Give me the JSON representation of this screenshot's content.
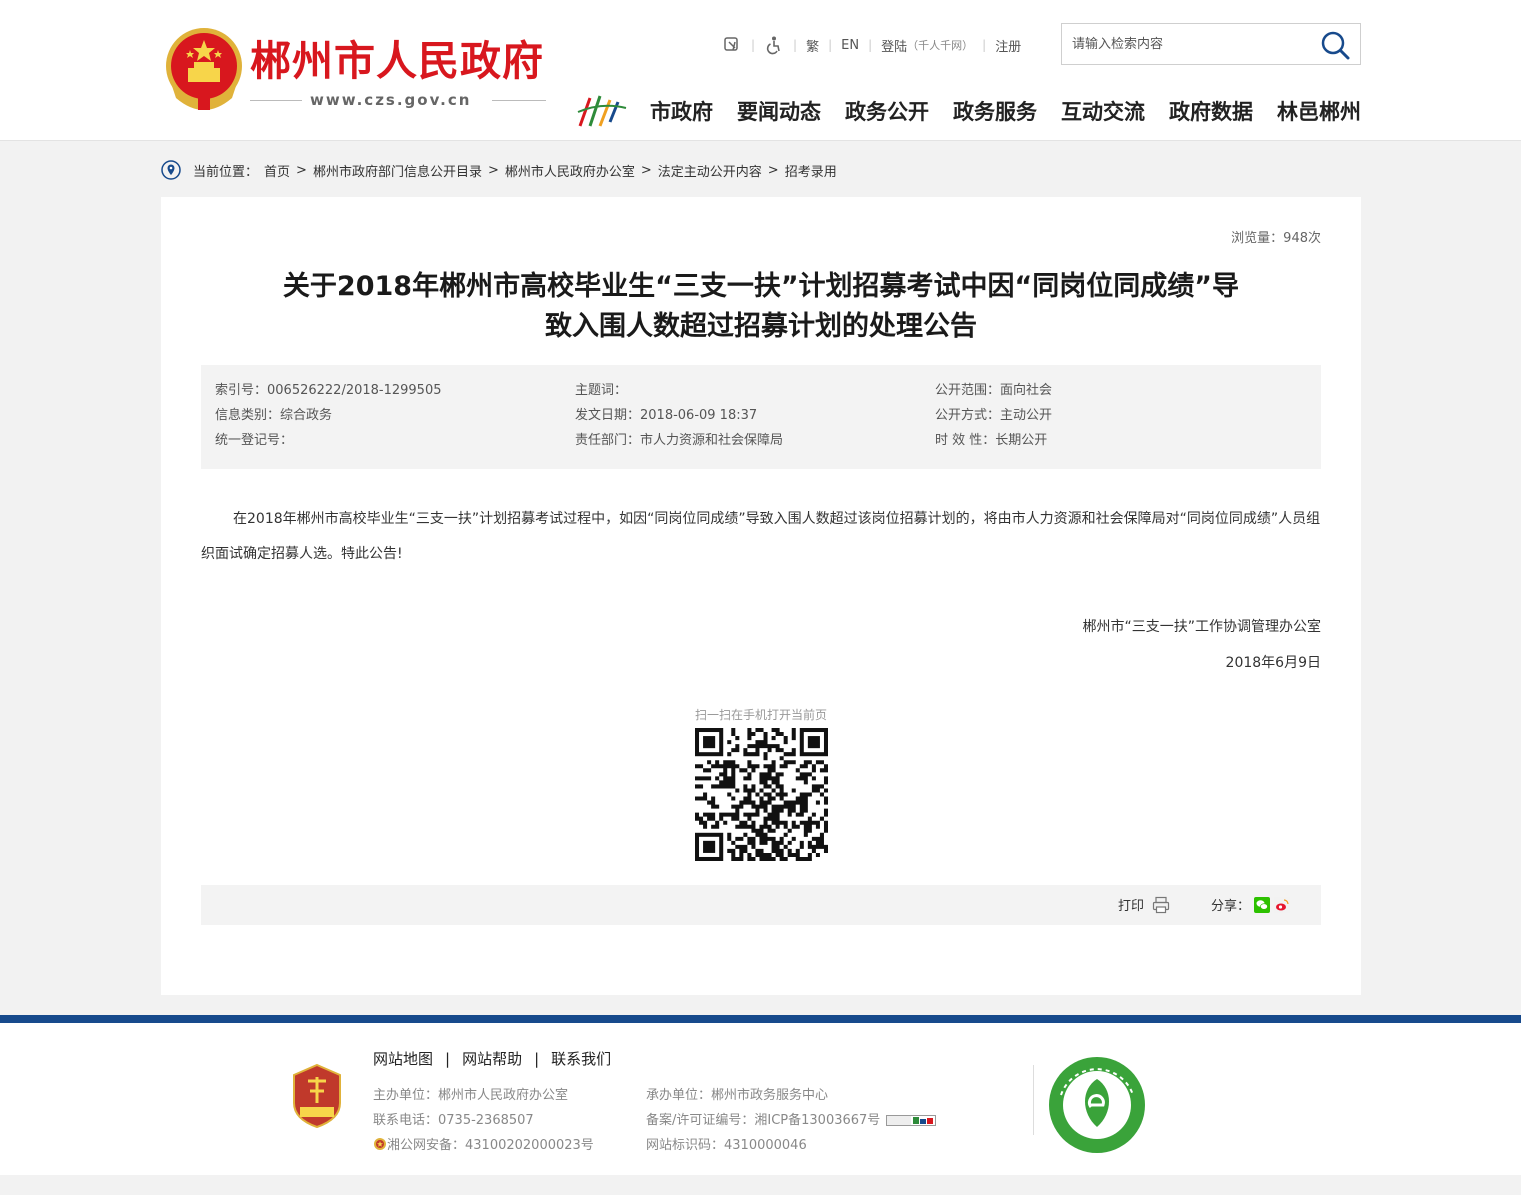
{
  "header": {
    "site_name": "郴州市人民政府",
    "site_url": "www.czs.gov.cn",
    "tools": {
      "traditional": "繁",
      "english": "EN",
      "login": "登陆",
      "login_note": "（千人千网）",
      "register": "注册"
    },
    "search": {
      "placeholder": "请输入检索内容"
    },
    "nav": [
      "市政府",
      "要闻动态",
      "政务公开",
      "政务服务",
      "互动交流",
      "政府数据",
      "林邑郴州"
    ]
  },
  "breadcrumb": {
    "label": "当前位置：",
    "items": [
      "首页",
      "郴州市政府部门信息公开目录",
      "郴州市人民政府办公室",
      "法定主动公开内容",
      "招考录用"
    ],
    "separator": ">"
  },
  "article": {
    "views": "浏览量：948次",
    "title_line1": "关于2018年郴州市高校毕业生“三支一扶”计划招募考试中因“同岗位同成绩”导",
    "title_line2": "致入围人数超过招募计划的处理公告",
    "meta": {
      "index_no": "索引号：006526222/2018-1299505",
      "category": "信息类别：综合政务",
      "reg_no": "统一登记号：",
      "keywords": "主题词：",
      "date": "发文日期：2018-06-09 18:37",
      "department": "责任部门：市人力资源和社会保障局",
      "scope": "公开范围：面向社会",
      "method": "公开方式：主动公开",
      "validity": "时 效 性：长期公开"
    },
    "body": "在2018年郴州市高校毕业生“三支一扶”计划招募考试过程中，如因“同岗位同成绩”导致入围人数超过该岗位招募计划的，将由市人力资源和社会保障局对“同岗位同成绩”人员组织面试确定招募人选。特此公告!",
    "signature": "郴州市“三支一扶”工作协调管理办公室",
    "sign_date": "2018年6月9日",
    "qr_label": "扫一扫在手机打开当前页",
    "print": "打印",
    "share": "分享："
  },
  "footer": {
    "links": [
      "网站地图",
      "网站帮助",
      "联系我们"
    ],
    "sponsor": "主办单位：郴州市人民政府办公室",
    "phone": "联系电话：0735-2368507",
    "police": "湘公网安备：43100202000023号",
    "organizer": "承办单位：郴州市政务服务中心",
    "icp": "备案/许可证编号：湘ICP备13003667号",
    "site_id": "网站标识码：4310000046"
  },
  "colors": {
    "brand_red": "#d8171e",
    "footer_blue": "#174a8c",
    "meta_bg": "#f3f3f3"
  }
}
